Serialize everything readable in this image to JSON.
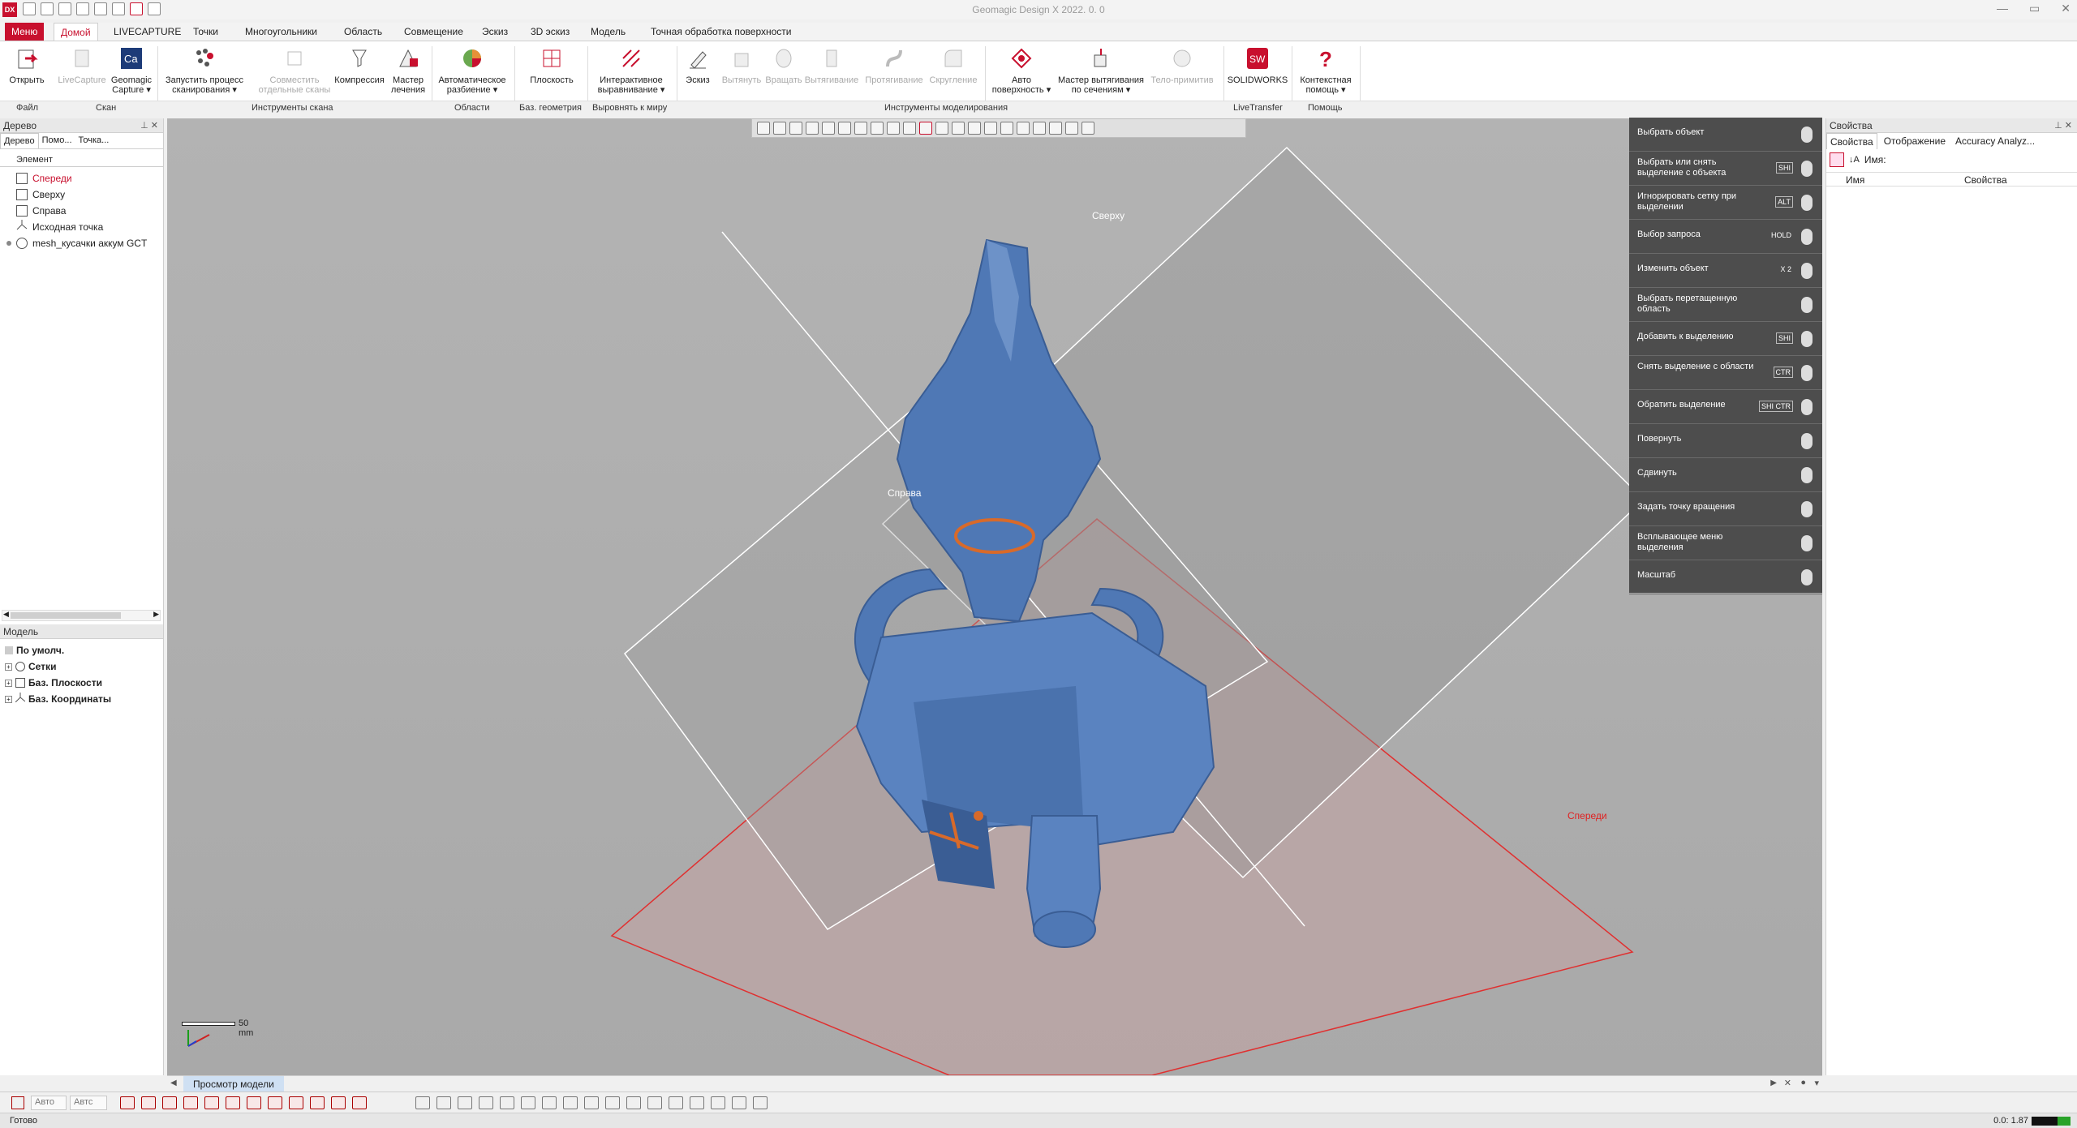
{
  "window": {
    "title": "Geomagic Design X 2022. 0. 0",
    "logo_text": "DX",
    "controls": [
      "—",
      "▭",
      "✕"
    ]
  },
  "ribbon": {
    "tabs": [
      "Меню",
      "Домой",
      "LIVECAPTURE",
      "Точки",
      "Многоугольники",
      "Область",
      "Совмещение",
      "Эскиз",
      "3D эскиз",
      "Модель",
      "Точная обработка поверхности"
    ],
    "buttons": {
      "open": "Открыть",
      "livecapture": "LiveCapture",
      "geomagic_capture": "Geomagic\nCapture ▾",
      "start_scan": "Запустить процесс\nсканирования ▾",
      "align_scans": "Совместить\nотдельные сканы",
      "compress": "Компрессия",
      "heal_wizard": "Мастер\nлечения",
      "auto_segment": "Автоматическое\nразбиение ▾",
      "plane": "Плоскость",
      "interactive_align": "Интерактивное\nвыравнивание ▾",
      "sketch": "Эскиз",
      "extrude": "Вытянуть",
      "revolve": "Вращать",
      "sweep": "Вытягивание",
      "loft": "Протягивание",
      "fillet": "Скругление",
      "auto_surface": "Авто\nповерхность ▾",
      "extrude_wizard": "Мастер вытягивания\nпо сечениям ▾",
      "primitive": "Тело-примитив",
      "solidworks": "SOLIDWORKS",
      "help": "Контекстная\nпомощь ▾"
    },
    "groups": [
      "Файл",
      "Скан",
      "Инструменты скана",
      "Области",
      "Баз. геометрия",
      "Выровнять к миру",
      "Инструменты моделирования",
      "LiveTransfer",
      "Помощь"
    ]
  },
  "left_panel": {
    "title": "Дерево",
    "tabs": [
      "Дерево",
      "Помо...",
      "Точка..."
    ],
    "column": "Элемент",
    "items": [
      "Спереди",
      "Сверху",
      "Справа",
      "Исходная точка",
      "mesh_кусачки аккум GCT"
    ],
    "model_title": "Модель",
    "model_items": [
      "По умолч.",
      "Сетки",
      "Баз. Плоскости",
      "Баз. Координаты"
    ]
  },
  "viewport": {
    "plane_labels": {
      "top": "Сверху",
      "right": "Справа",
      "front": "Спереди"
    },
    "scale_label": "50 mm",
    "view_tab": "Просмотр модели"
  },
  "mouse_help": [
    {
      "label": "Выбрать объект",
      "key": ""
    },
    {
      "label": "Выбрать или снять выделение с объекта",
      "key": "SHI"
    },
    {
      "label": "Игнорировать сетку при выделении",
      "key": "ALT"
    },
    {
      "label": "Выбор запроса",
      "key": "HOLD"
    },
    {
      "label": "Изменить объект",
      "key": "X 2"
    },
    {
      "label": "Выбрать перетащенную область",
      "key": ""
    },
    {
      "label": "Добавить к выделению",
      "key": "SHI"
    },
    {
      "label": "Снять выделение с области",
      "key": "CTR"
    },
    {
      "label": "Обратить выделение",
      "key": "SHI CTR"
    },
    {
      "label": "Повернуть",
      "key": ""
    },
    {
      "label": "Сдвинуть",
      "key": ""
    },
    {
      "label": "Задать точку вращения",
      "key": ""
    },
    {
      "label": "Всплывающее меню выделения",
      "key": ""
    },
    {
      "label": "Масштаб",
      "key": ""
    }
  ],
  "right_panel": {
    "title": "Свойства",
    "tabs": [
      "Свойства",
      "Отображение",
      "Accuracy Analyz..."
    ],
    "name_label": "Имя:",
    "col_name": "Имя",
    "col_props": "Свойства"
  },
  "bottom": {
    "select_auto1": "Авто",
    "select_auto2": "Автс"
  },
  "status": {
    "text": "Готово",
    "fps": "0.0: 1.87"
  },
  "colors": {
    "accent": "#c8102e",
    "viewport_bg": "#aeaeae",
    "mesh": "#4f78b5"
  }
}
